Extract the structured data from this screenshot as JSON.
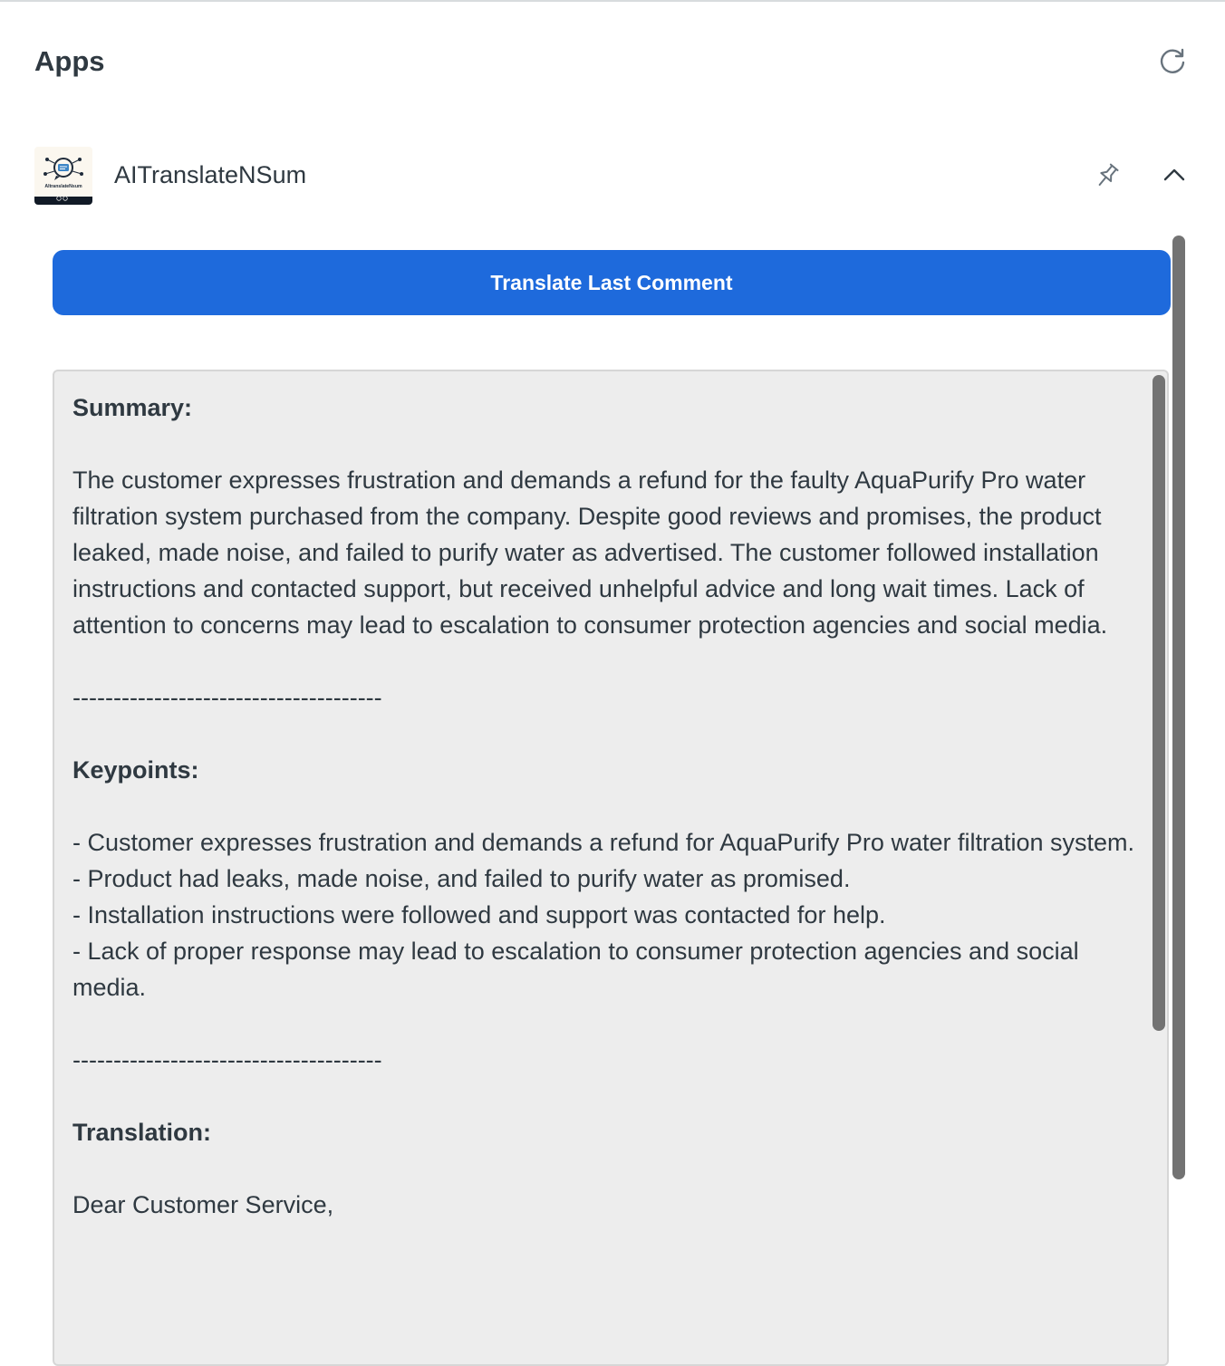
{
  "header": {
    "title": "Apps",
    "refresh_icon": "refresh-icon"
  },
  "app": {
    "name": "AITranslateNSum",
    "logo_icon": "aitranslatensum-logo",
    "logo_caption": "AItranslateNsum",
    "pin_icon": "pin-icon",
    "collapse_icon": "chevron-up-icon"
  },
  "actions": {
    "translate_label": "Translate Last Comment"
  },
  "result": {
    "summary_heading": "Summary:",
    "summary_body": "The customer expresses frustration and demands a refund for the faulty AquaPurify Pro water filtration system purchased from the company. Despite good reviews and promises, the product leaked, made noise, and failed to purify water as advertised. The customer followed installation instructions and contacted support, but received unhelpful advice and long wait times. Lack of attention to concerns may lead to escalation to consumer protection agencies and social media.",
    "separator_1": "--------------------------------------",
    "keypoints_heading": "Keypoints:",
    "keypoints": [
      "- Customer expresses frustration and demands a refund for AquaPurify Pro water filtration system.",
      "- Product had leaks, made noise, and failed to purify water as promised.",
      "- Installation instructions were followed and support was contacted for help.",
      "- Lack of proper response may lead to escalation to consumer protection agencies and social media."
    ],
    "separator_2": "--------------------------------------",
    "translation_heading": "Translation:",
    "translation_greeting": "Dear Customer Service,"
  },
  "colors": {
    "primary_button": "#1e6adc",
    "panel_background": "#ededed",
    "scrollbar": "#737373",
    "text": "#2f3941"
  }
}
